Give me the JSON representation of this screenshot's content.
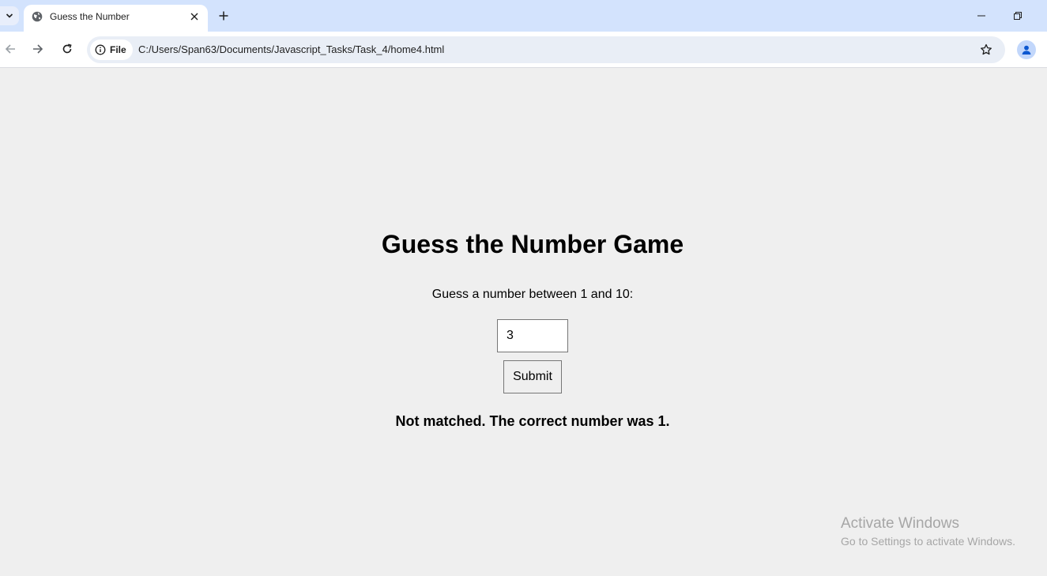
{
  "browser": {
    "tab": {
      "title": "Guess the Number"
    },
    "address": {
      "chip_label": "File",
      "url": "C:/Users/Span63/Documents/Javascript_Tasks/Task_4/home4.html"
    }
  },
  "page": {
    "heading": "Guess the Number Game",
    "prompt": "Guess a number between 1 and 10:",
    "input_value": "3",
    "submit_label": "Submit",
    "result": "Not matched. The correct number was 1."
  },
  "watermark": {
    "title": "Activate Windows",
    "subtitle": "Go to Settings to activate Windows."
  },
  "icons": [
    "tab-search-icon",
    "globe-icon",
    "close-icon",
    "plus-icon",
    "minimize-icon",
    "restore-icon",
    "back-arrow-icon",
    "forward-arrow-icon",
    "reload-icon",
    "info-icon",
    "star-icon",
    "profile-icon"
  ],
  "colors": {
    "tabstrip": "#d3e3fd",
    "omnibox": "#e9eef6",
    "page_bg": "#efefef"
  }
}
